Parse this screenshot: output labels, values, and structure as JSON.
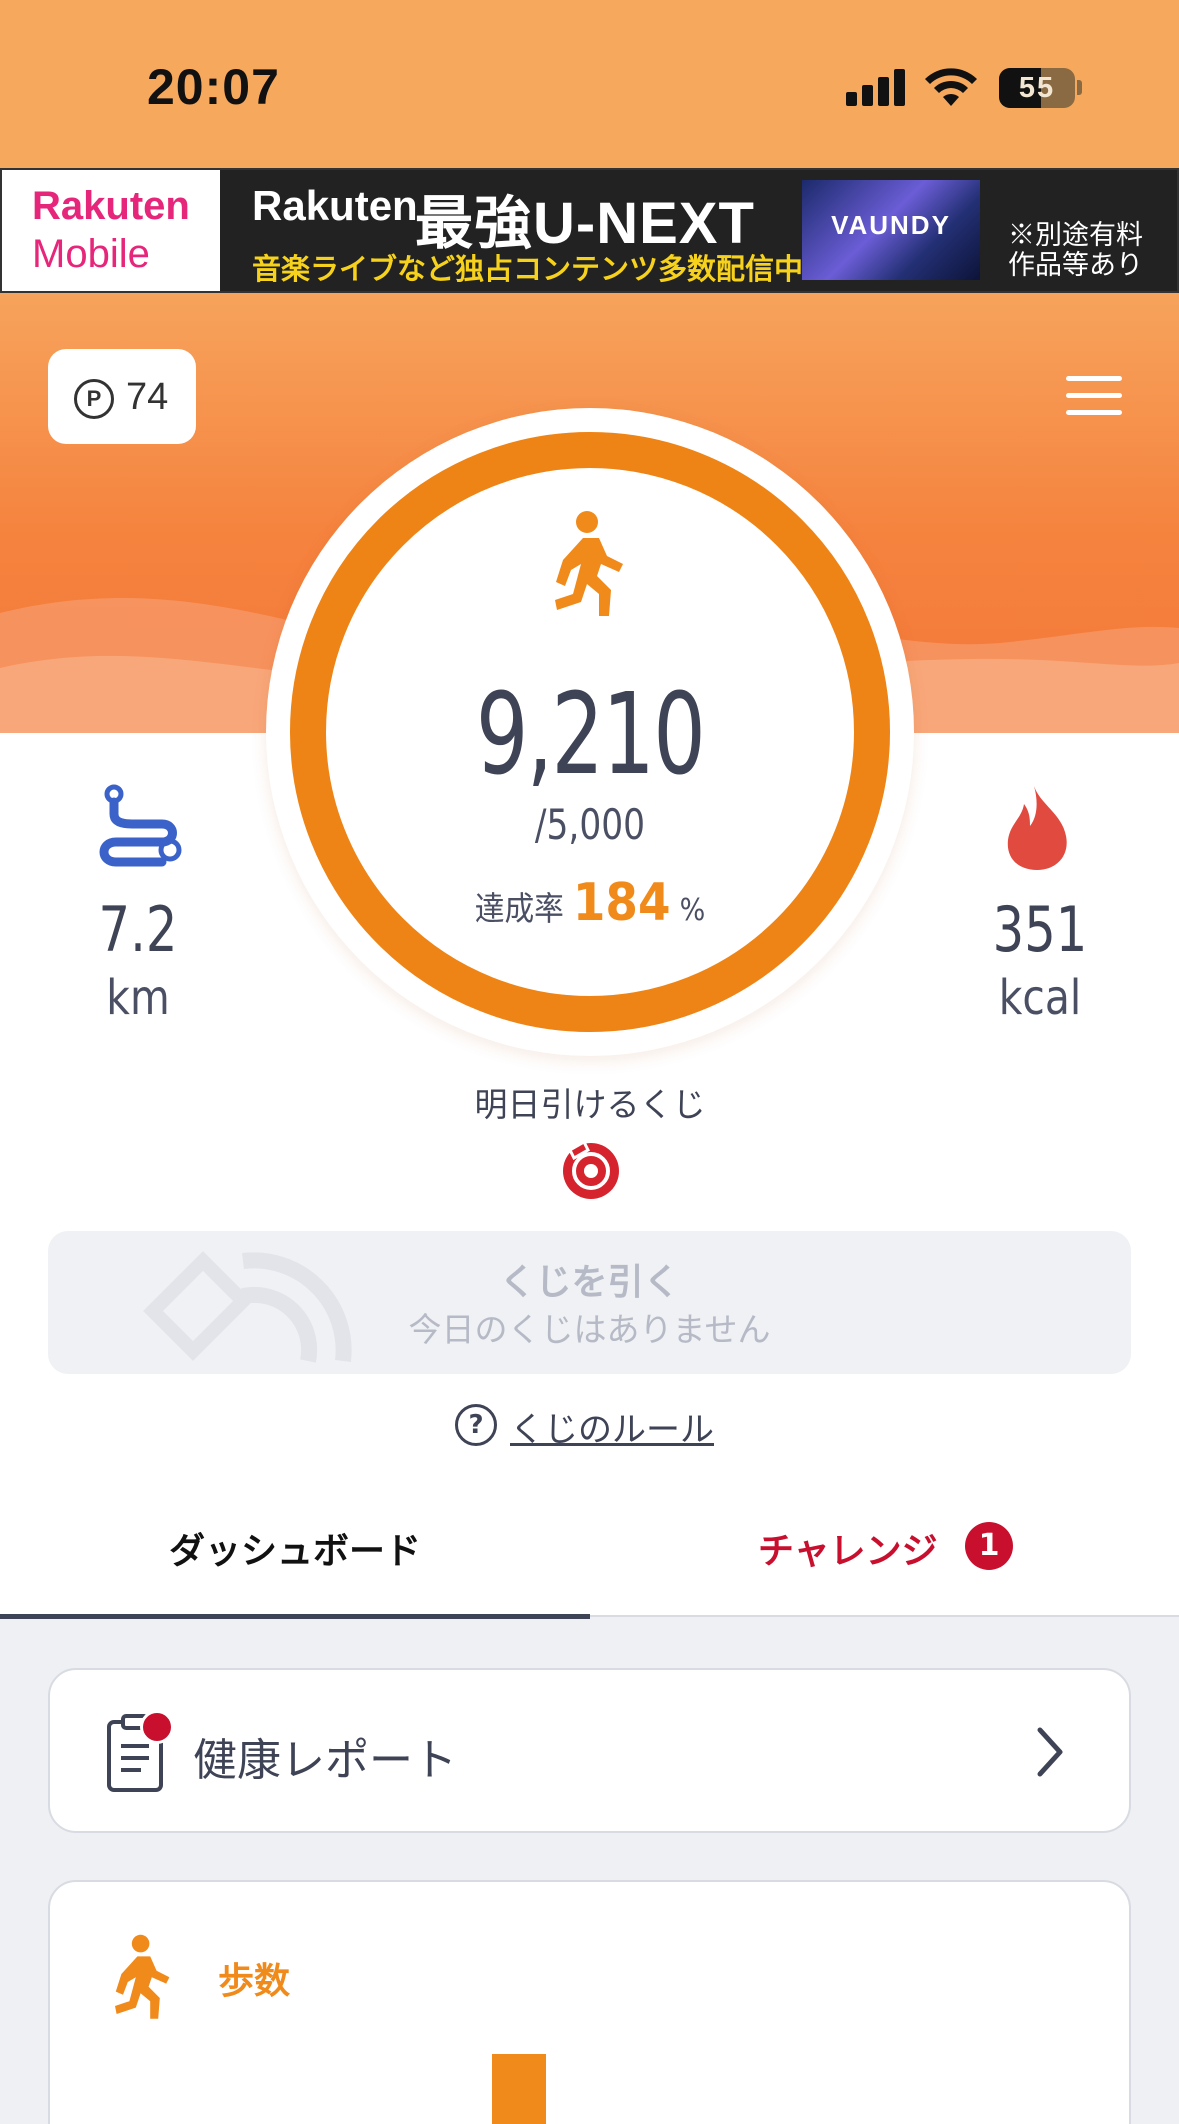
{
  "status_bar": {
    "time": "20:07",
    "battery": "55",
    "battery_level": 0.55
  },
  "ad": {
    "logo_line1": "Rakuten",
    "logo_line2": "Mobile",
    "brand": "Rakuten",
    "headline": "最強U-NEXT",
    "subline": "音楽ライブなど独占コンテンツ多数配信中!",
    "image_text": "VAUNDY",
    "note_line1": "※別途有料",
    "note_line2": "作品等あり"
  },
  "header": {
    "points_symbol": "P",
    "points": "74",
    "menu_icon": "hamburger-menu-icon"
  },
  "progress": {
    "steps": "9,210",
    "goal": "/5,000",
    "rate_label": "達成率",
    "rate": "184",
    "rate_unit": "%",
    "fraction": 1.0
  },
  "stats": {
    "distance": "7.2",
    "distance_unit": "km",
    "calories": "351",
    "calories_unit": "kcal"
  },
  "lottery": {
    "tomorrow_label": "明日引けるくじ",
    "button_label": "くじを引く",
    "button_sub": "今日のくじはありません",
    "rules_icon": "?",
    "rules_link": "くじのルール"
  },
  "tabs": {
    "dashboard": "ダッシュボード",
    "challenge": "チャレンジ",
    "challenge_badge": "1"
  },
  "cards": {
    "health_report": "健康レポート",
    "steps_title": "歩数"
  },
  "colors": {
    "accent_orange": "#f08a1a",
    "header_orange": "#f6a85c",
    "challenge_red": "#c8102e",
    "text_dark": "#3e4356",
    "distance_blue": "#3a62c9",
    "fire_red": "#e04a3f"
  }
}
